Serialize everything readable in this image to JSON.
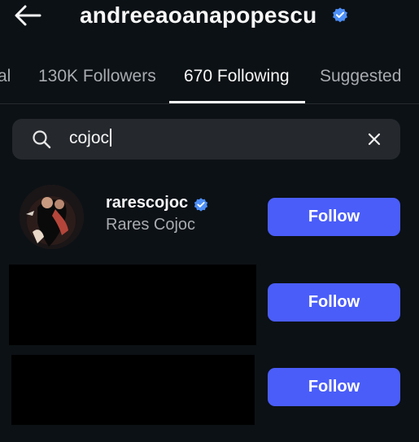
{
  "header": {
    "title": "andreeaoanapopescu",
    "back_icon": "arrow-left-icon",
    "verified_icon": "verified-badge-icon"
  },
  "tabs": [
    {
      "label": "al",
      "active": false
    },
    {
      "label": "130K Followers",
      "active": false
    },
    {
      "label": "670 Following",
      "active": true
    },
    {
      "label": "Suggested",
      "active": false
    }
  ],
  "search": {
    "value": "cojoc",
    "search_icon": "search-icon",
    "clear_icon": "close-icon"
  },
  "results": [
    {
      "username": "rarescojoc",
      "full_name": "Rares Cojoc",
      "verified": true,
      "button_label": "Follow"
    },
    {
      "username": "",
      "full_name": "",
      "redacted": true,
      "button_label": "Follow"
    },
    {
      "username": "",
      "full_name": "",
      "redacted": true,
      "button_label": "Follow"
    }
  ],
  "colors": {
    "background": "#0c1115",
    "accent_button": "#4a5df9",
    "verified_badge": "#4d8ff8",
    "search_bg": "#25292e",
    "muted_text": "#a8acb1"
  }
}
